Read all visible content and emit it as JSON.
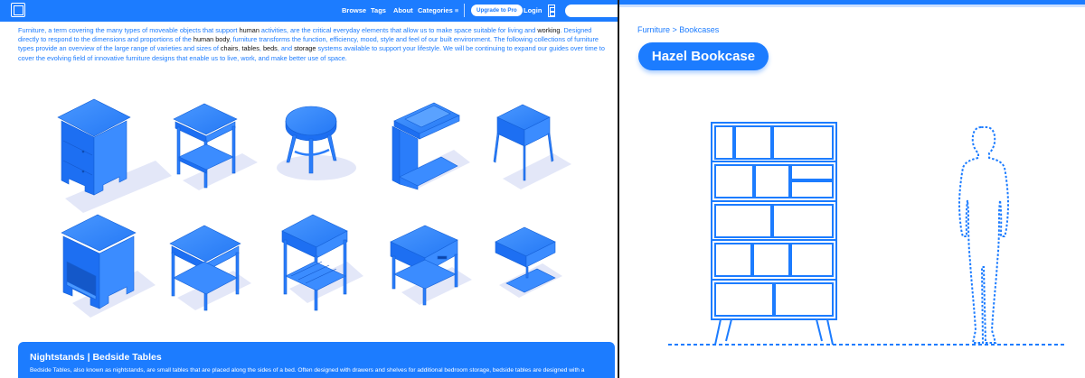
{
  "nav": {
    "links": [
      "Browse",
      "Tags",
      "About",
      "Categories ≡"
    ],
    "pro_label": "Upgrade to Pro",
    "login_label": "Login",
    "search_placeholder": ""
  },
  "intro": {
    "part1": "Furniture, a term covering the many types of moveable objects that support ",
    "hl1": "human",
    "part2": " activities, are the critical everyday elements that allow us to make space suitable for living and ",
    "hl2": "working",
    "part3": ". Designed directly to respond to the dimensions and proportions of the ",
    "hl3": "human body",
    "part4": ", furniture transforms the function, efficiency, mood, style and feel of our built environment. The following collections of furniture types provide an overview of the large range of varieties and sizes of ",
    "hl4": "chairs",
    "sep1": ", ",
    "hl5": "tables",
    "sep2": ", ",
    "hl6": "beds",
    "sep3": ", and ",
    "hl7": "storage",
    "part5": " systems available to support your lifestyle. We will be continuing to expand our guides over time to cover the evolving field of innovative furniture designs that enable us to live, work, and make better use of space."
  },
  "furniture_items": [
    "nightstand-drawers",
    "nightstand-legs-shelf",
    "round-side-table",
    "c-shaped-side-table",
    "nightstand-open-top",
    "nightstand-open-shelf",
    "nightstand-frame-shelf",
    "nightstand-slatted",
    "nightstand-drawer-frame",
    "floating-nightstand"
  ],
  "card": {
    "title": "Nightstands | Bedside Tables",
    "text": "Bedside Tables, also known as nightstands, are small tables that are placed along the sides of a bed. Often designed with drawers and shelves for additional bedroom storage, bedside tables are designed with a"
  },
  "detail": {
    "breadcrumb": "Furniture > Bookcases",
    "title": "Hazel Bookcase"
  },
  "colors": {
    "accent": "#1c7cff",
    "furniture": "#2a7dfa",
    "shadow": "#e3e7f8"
  }
}
